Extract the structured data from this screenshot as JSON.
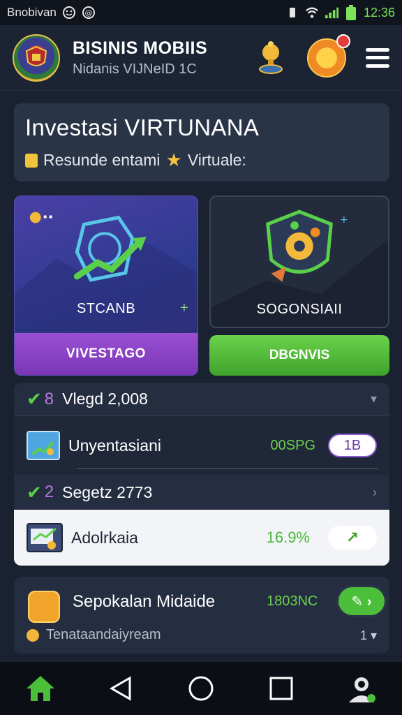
{
  "status_bar": {
    "carrier": "Bnobivan",
    "time": "12:36"
  },
  "header": {
    "title": "BISINIS MOBIIS",
    "subtitle": "Nidanis VIJNeID 1C"
  },
  "hero": {
    "title": "Investasi VIRTUNANA",
    "subtitle_left": "Resunde entami",
    "subtitle_right": "Virtuale:"
  },
  "tiles": [
    {
      "label": "STCANB",
      "button": "VIVESTAGO"
    },
    {
      "label": "SOGONSIAII",
      "button": "DBGNVIS"
    }
  ],
  "list": {
    "rows": [
      {
        "text": "Vlegd 2,008",
        "num": "8"
      },
      {
        "text": "Unyentasiani",
        "value": "00SPG",
        "pill": "1B"
      },
      {
        "text": "Segetz 2773",
        "num": "2"
      },
      {
        "text": "Adolrkaia",
        "value": "16.9%"
      }
    ]
  },
  "bottom_card": {
    "title": "Sepokalan Midaide",
    "value": "1803NC",
    "subtitle": "Tenataandaiyream",
    "count": "1"
  },
  "colors": {
    "accent_green": "#4bbf39",
    "accent_purple": "#8b4fc8",
    "background": "#1a2130"
  }
}
